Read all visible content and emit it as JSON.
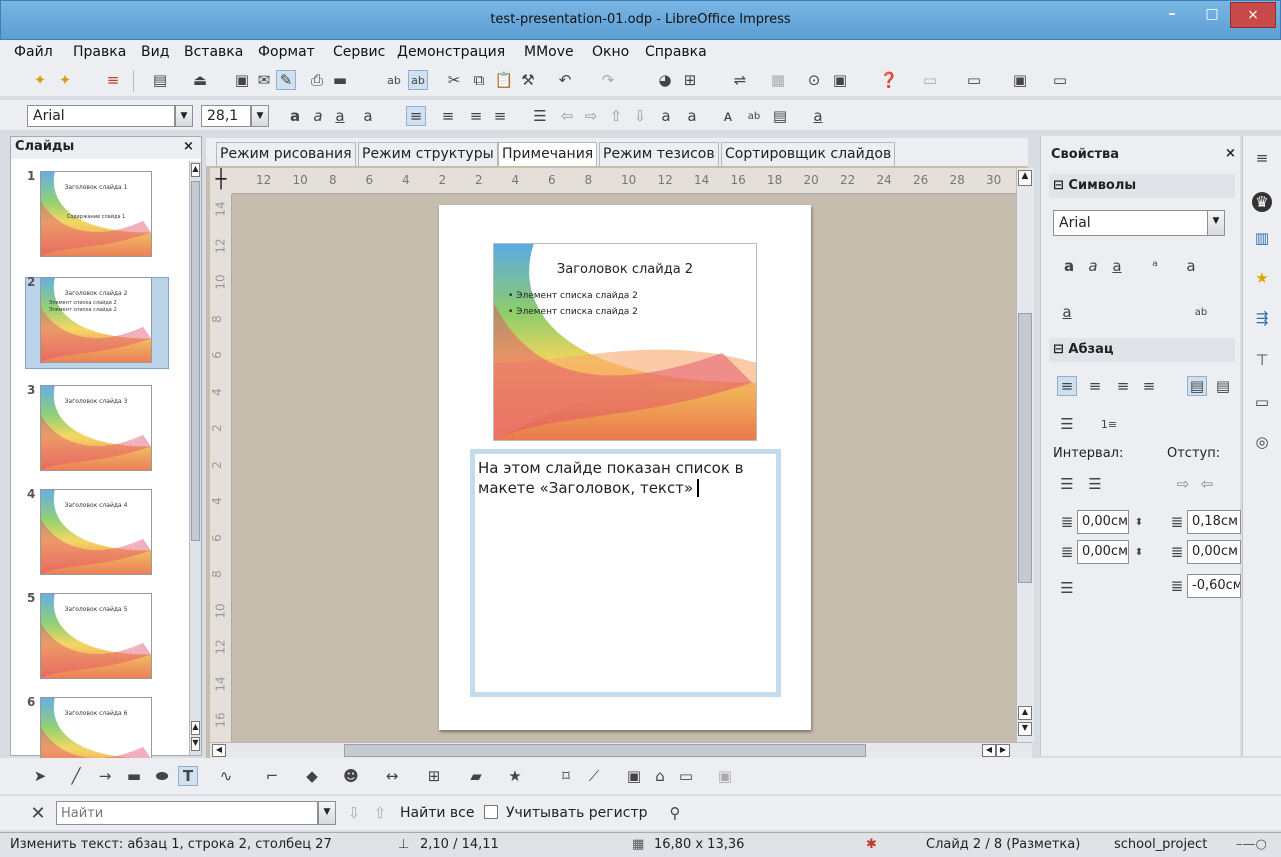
{
  "window": {
    "title": "test-presentation-01.odp - LibreOffice Impress",
    "min": "–",
    "max": "□",
    "close": "×"
  },
  "menu": [
    "Файл",
    "Правка",
    "Вид",
    "Вставка",
    "Формат",
    "Сервис",
    "Демонстрация",
    "MMove",
    "Окно",
    "Справка"
  ],
  "format_bar": {
    "font": "Arial",
    "size": "28,1"
  },
  "slides_panel": {
    "title": "Слайды",
    "close": "×",
    "slides": [
      {
        "num": "1",
        "title": "Заголовок слайда 1",
        "sub": "Содержание слайда 1",
        "items": []
      },
      {
        "num": "2",
        "title": "Заголовок слайда 2",
        "sub": "",
        "items": [
          "Элемент списка слайда 2",
          "Элемент списка слайда 2"
        ]
      },
      {
        "num": "3",
        "title": "Заголовок слайда 3",
        "sub": "",
        "items": []
      },
      {
        "num": "4",
        "title": "Заголовок слайда 4",
        "sub": "",
        "items": []
      },
      {
        "num": "5",
        "title": "Заголовок слайда 5",
        "sub": "",
        "items": []
      },
      {
        "num": "6",
        "title": "Заголовок слайда 6",
        "sub": "",
        "items": []
      }
    ],
    "selected": "2"
  },
  "view_tabs": [
    "Режим рисования",
    "Режим структуры",
    "Примечания",
    "Режим тезисов",
    "Сортировщик слайдов"
  ],
  "active_tab": "Примечания",
  "ruler": {
    "h_labels": [
      "12",
      "10",
      "8",
      "6",
      "4",
      "2",
      "2",
      "4",
      "6",
      "8",
      "10",
      "12",
      "14",
      "16",
      "18",
      "20",
      "22",
      "24",
      "26",
      "28",
      "30"
    ],
    "v_labels": [
      "14",
      "12",
      "10",
      "8",
      "6",
      "4",
      "2",
      "2",
      "4",
      "6",
      "8",
      "10",
      "12",
      "14",
      "16"
    ]
  },
  "slide": {
    "title": "Заголовок слайда 2",
    "items": [
      "Элемент списка слайда 2",
      "Элемент списка слайда 2"
    ]
  },
  "notes": {
    "text": "На этом слайде показан список в макете «Заголовок, текст»"
  },
  "sidebar": {
    "title": "Свойства",
    "close": "×",
    "characters": {
      "title": "Символы",
      "font": "Arial"
    },
    "paragraph": {
      "title": "Абзац",
      "spacing_label": "Интервал:",
      "indent_label": "Отступ:",
      "above": "0,00см",
      "below": "0,00см",
      "before_text": "0,18см",
      "after_text": "0,00см",
      "first_line": "-0,60см"
    }
  },
  "find": {
    "placeholder": "Найти",
    "find_all": "Найти все",
    "match_case": "Учитывать регистр"
  },
  "status": {
    "edit": "Изменить текст: абзац 1, строка 2, столбец 27",
    "pos": "2,10 / 14,11",
    "size": "16,80 x 13,36",
    "slide": "Слайд 2 / 8 (Разметка)",
    "master": "school_project"
  }
}
